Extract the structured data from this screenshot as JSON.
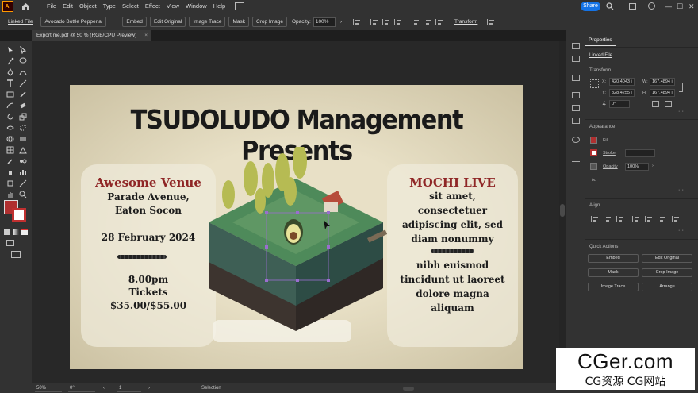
{
  "app": {
    "logo": "Ai",
    "menus": [
      "File",
      "Edit",
      "Object",
      "Type",
      "Select",
      "Effect",
      "View",
      "Window",
      "Help"
    ],
    "share_label": "Share",
    "window_controls": [
      "—",
      "☐",
      "✕"
    ]
  },
  "controlbar": {
    "linked_file": "Linked File",
    "file_name": "Avocado Bottle Pepper.ai",
    "embed": "Embed",
    "edit_original": "Edit Original",
    "image_trace": "Image Trace",
    "mask": "Mask",
    "crop_image": "Crop Image",
    "opacity_label": "Opacity:",
    "opacity_value": "100%",
    "transform": "Transform"
  },
  "document": {
    "tab_title": "Export me.pdf @ 50 % (RGB/CPU Preview)",
    "close": "×"
  },
  "artboard": {
    "headline": "TSUDOLUDO Management Presents",
    "left": {
      "venue_title": "Awesome Venue",
      "address1": "Parade Avenue,",
      "address2": "Eaton Socon",
      "date": "28 February 2024",
      "time": "8.00pm",
      "tickets": "Tickets",
      "price": "$35.00/$55.00"
    },
    "right": {
      "title": "MOCHI LIVE",
      "line1": "sit amet,",
      "line2": "consectetuer",
      "line3": "adipiscing elit, sed",
      "line4": "diam nonummy",
      "line5": "nibh euismod",
      "line6": "tincidunt ut laoreet",
      "line7": "dolore magna",
      "line8": "aliquam"
    }
  },
  "properties": {
    "tab": "Properties",
    "object_type": "Linked File",
    "transform_label": "Transform",
    "x_label": "X:",
    "x_value": "420.4043 j",
    "y_label": "Y:",
    "y_value": "328.4255 j",
    "w_label": "W:",
    "w_value": "167.4894 j",
    "h_label": "H:",
    "h_value": "167.4894 j",
    "angle_value": "0°",
    "appearance_label": "Appearance",
    "fill_label": "Fill",
    "stroke_label": "Stroke",
    "opacity_label": "Opacity",
    "opacity_value": "100%",
    "fx": "fx.",
    "align_label": "Align",
    "quick_actions_label": "Quick Actions",
    "qa_embed": "Embed",
    "qa_edit_original": "Edit Original",
    "qa_mask": "Mask",
    "qa_crop_image": "Crop Image",
    "qa_image_trace": "Image Trace",
    "qa_arrange": "Arrange",
    "fill_color": "#b03030"
  },
  "statusbar": {
    "zoom": "50%",
    "rotation": "0°",
    "artboard": "1",
    "mode": "Selection"
  },
  "watermark": {
    "big": "CGer.com",
    "small": "CG资源 CG网站"
  }
}
